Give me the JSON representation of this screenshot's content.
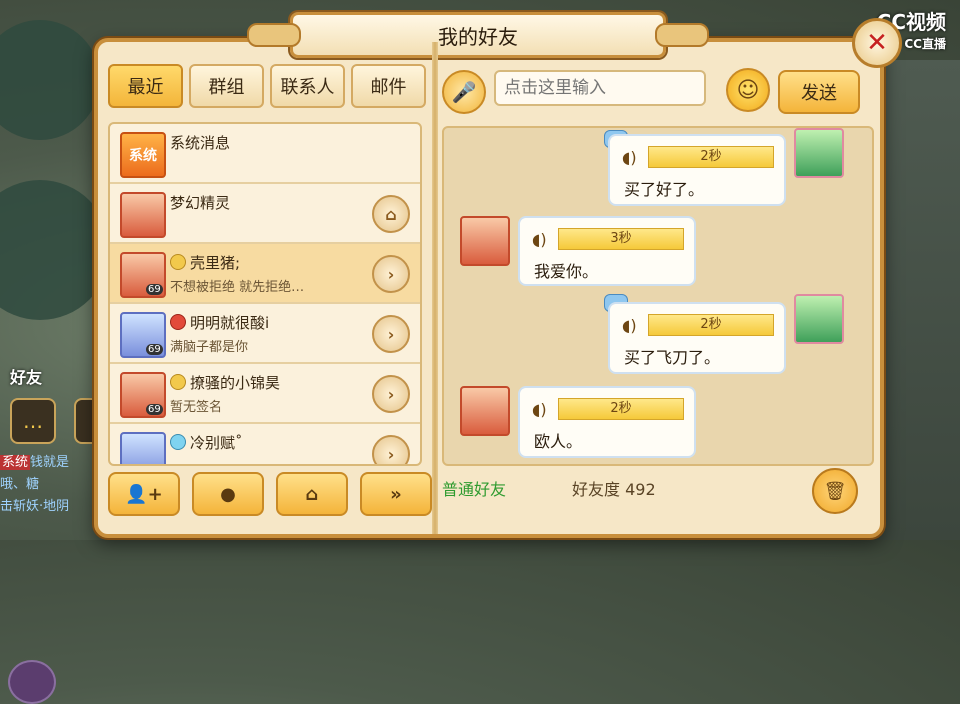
{
  "window": {
    "title": "我的好友",
    "watermark_line1": "CC视频",
    "watermark_line2": "CC直播"
  },
  "tabs": [
    {
      "label": "最近",
      "active": true
    },
    {
      "label": "群组",
      "active": false
    },
    {
      "label": "联系人",
      "active": false
    },
    {
      "label": "邮件",
      "active": false
    }
  ],
  "contacts": [
    {
      "name": "系统消息",
      "status": "",
      "avatar_text": "系统",
      "level": "",
      "action": ""
    },
    {
      "name": "梦幻精灵",
      "status": "",
      "avatar_text": "",
      "level": "",
      "action": "home"
    },
    {
      "name": "壳里猪;",
      "status": "不想被拒绝 就先拒绝…",
      "avatar_text": "",
      "level": "69",
      "action": "chevron"
    },
    {
      "name": "明明就很酸i",
      "status": "满脑子都是你",
      "avatar_text": "",
      "level": "69",
      "action": "chevron"
    },
    {
      "name": "撩骚的小锦昊",
      "status": "暂无签名",
      "avatar_text": "",
      "level": "69",
      "action": "chevron"
    },
    {
      "name": "冷别赋˚",
      "status": "",
      "avatar_text": "",
      "level": "",
      "action": "chevron"
    }
  ],
  "input": {
    "placeholder": "点击这里输入",
    "send_label": "发送"
  },
  "messages": [
    {
      "side": "right",
      "duration": "2秒",
      "text": "买了好了。"
    },
    {
      "side": "left",
      "duration": "3秒",
      "text": "我爱你。"
    },
    {
      "side": "right",
      "duration": "2秒",
      "text": "买了飞刀了。"
    },
    {
      "side": "left",
      "duration": "2秒",
      "text": "欧人。"
    }
  ],
  "footer": {
    "friend_type": "普通好友",
    "friendship_label": "好友度",
    "friendship_value": "492"
  },
  "background": {
    "friend_label": "好友",
    "chat_tag": "系统",
    "chat_lines": [
      "钱就是",
      "哦、糖",
      "击斩妖·地阴"
    ]
  }
}
